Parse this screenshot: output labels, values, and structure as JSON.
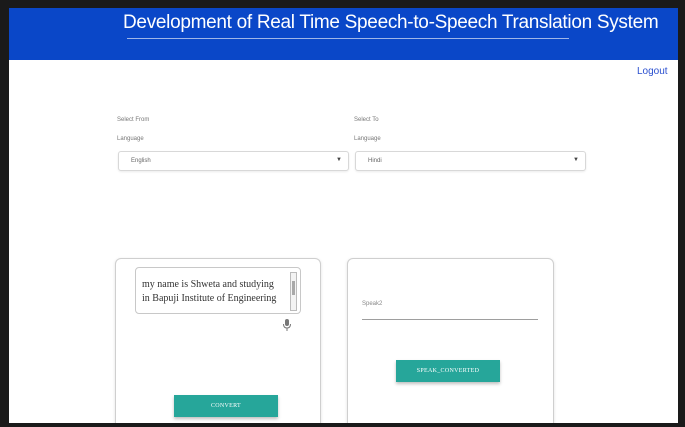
{
  "header": {
    "title": "Development of Real Time Speech-to-Speech Translation System"
  },
  "nav": {
    "logout_label": "Logout"
  },
  "from": {
    "label_line1": "Select From",
    "label_line2": "Language",
    "selected": "English"
  },
  "to": {
    "label_line1": "Select To",
    "label_line2": "Language",
    "selected": "Hindi"
  },
  "input_panel": {
    "text_line1": "my name is Shweta and studying",
    "text_line2": "in Bapuji Institute of Engineering",
    "convert_label": "CONVERT"
  },
  "output_panel": {
    "speak_placeholder": "Speak2",
    "speak_button_label": "SPEAK_CONVERTED"
  },
  "colors": {
    "header_bg": "#0a47c8",
    "accent": "#26a69a",
    "link": "#2a4fcf"
  },
  "icons": [
    "dropdown-arrow-icon",
    "microphone-icon",
    "scroll-arrow-icon"
  ]
}
